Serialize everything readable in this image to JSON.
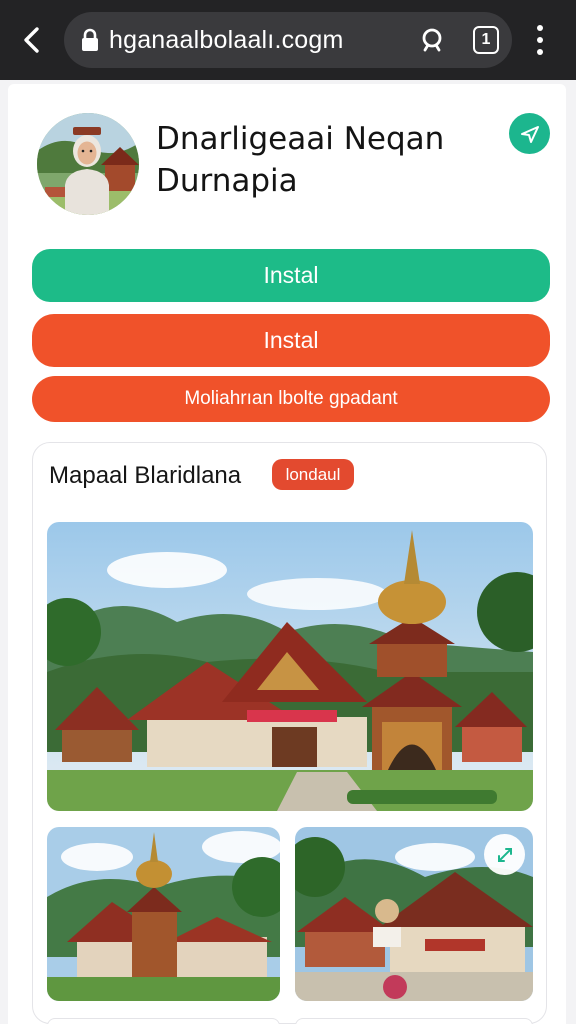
{
  "browser": {
    "url": "hganaalbolaalı.cogm",
    "tab_count": "1"
  },
  "app": {
    "title_line1": "Dnarligeaai Neqan",
    "title_line2": "Durnapia"
  },
  "actions": {
    "install_primary": "Instal",
    "install_secondary": "Instal",
    "more": "Moliahrıan lbolte gpadant"
  },
  "gallery": {
    "title": "Mapaal Blaridlana",
    "badge": "londaul"
  },
  "icons": {
    "back": "back-arrow-icon",
    "lock": "lock-icon",
    "search": "search-icon",
    "tabs": "tabs-icon",
    "menu": "more-vert-icon",
    "share": "share-icon",
    "expand": "expand-icon"
  },
  "colors": {
    "chrome": "#232325",
    "green": "#1dbb88",
    "orange": "#f0522a",
    "badge": "#e34a2f"
  }
}
